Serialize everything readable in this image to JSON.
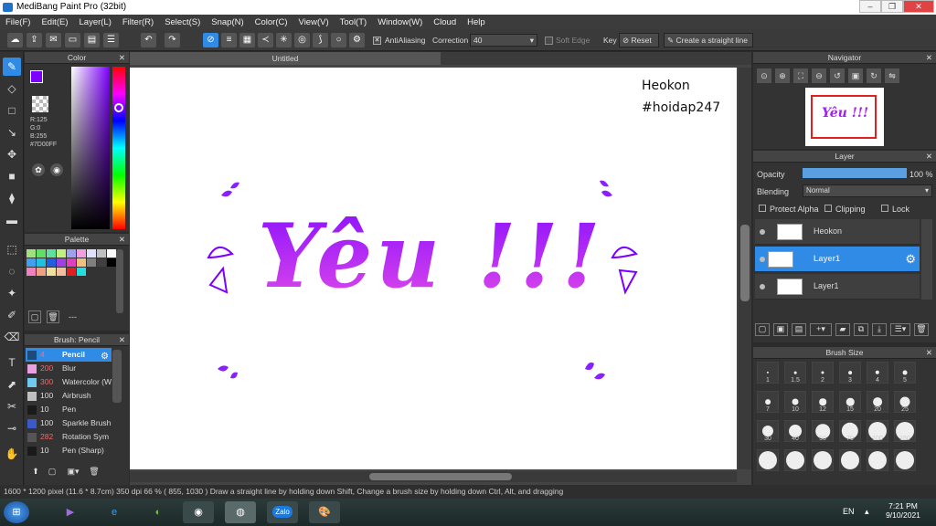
{
  "window": {
    "title": "MediBang Paint Pro (32bit)"
  },
  "menu": [
    "File(F)",
    "Edit(E)",
    "Layer(L)",
    "Filter(R)",
    "Select(S)",
    "Snap(N)",
    "Color(C)",
    "View(V)",
    "Tool(T)",
    "Window(W)",
    "Cloud",
    "Help"
  ],
  "toolbar": {
    "antialias": "AntiAliasing",
    "correction_label": "Correction",
    "correction_value": "40",
    "soft_edge": "Soft Edge",
    "key_label": "Key",
    "reset": "Reset",
    "straight_line": "Create a straight line"
  },
  "color_panel": {
    "title": "Color",
    "r": "R:125",
    "g": "G:0",
    "b": "B:255",
    "hex": "#7D00FF",
    "accent": "#7d00ff"
  },
  "palette_panel": {
    "title": "Palette",
    "more": "---"
  },
  "brush_panel": {
    "title": "Brush: Pencil",
    "items": [
      {
        "size": "4",
        "name": "Pencil",
        "color": "#1e4a7a"
      },
      {
        "size": "200",
        "name": "Blur",
        "color": "#e8a0e0"
      },
      {
        "size": "300",
        "name": "Watercolor (W",
        "color": "#6ec8f0"
      },
      {
        "size": "100",
        "name": "Airbrush",
        "color": "#c0c0c0"
      },
      {
        "size": "10",
        "name": "Pen",
        "color": "#1a1a1a"
      },
      {
        "size": "100",
        "name": "Sparkle Brush",
        "color": "#3a5ac8"
      },
      {
        "size": "282",
        "name": "Rotation Sym",
        "color": "#555555"
      },
      {
        "size": "10",
        "name": "Pen (Sharp)",
        "color": "#1a1a1a"
      }
    ]
  },
  "canvas": {
    "tab": "Untitled",
    "author": "Heokon",
    "tag": "#hoidap247",
    "main_text": "Yêu !!!"
  },
  "navigator": {
    "title": "Navigator"
  },
  "layer_panel": {
    "title": "Layer",
    "opacity_label": "Opacity",
    "opacity_value": "100 %",
    "opacity": 1.0,
    "blending_label": "Blending",
    "blending_value": "Normal",
    "protect_alpha": "Protect Alpha",
    "clipping": "Clipping",
    "lock": "Lock",
    "layers": [
      {
        "name": "Heokon",
        "selected": false
      },
      {
        "name": "Layer1",
        "selected": true
      },
      {
        "name": "Layer1",
        "selected": false
      }
    ]
  },
  "brush_size": {
    "title": "Brush Size",
    "labels": [
      "1",
      "1.5",
      "2",
      "3",
      "4",
      "5",
      "7",
      "10",
      "12",
      "15",
      "20",
      "25",
      "30",
      "40",
      "50",
      "70",
      "100",
      "150"
    ]
  },
  "status": {
    "text": "1600 * 1200 pixel   (11.6 * 8.7cm)   350 dpi   66 %   ( 855, 1030 )   Draw a straight line by holding down Shift, Change a brush size by holding down Ctrl, Alt, and dragging"
  },
  "taskbar": {
    "lang": "EN",
    "time": "7:21 PM",
    "date": "9/10/2021",
    "zalo": "Zalo"
  }
}
